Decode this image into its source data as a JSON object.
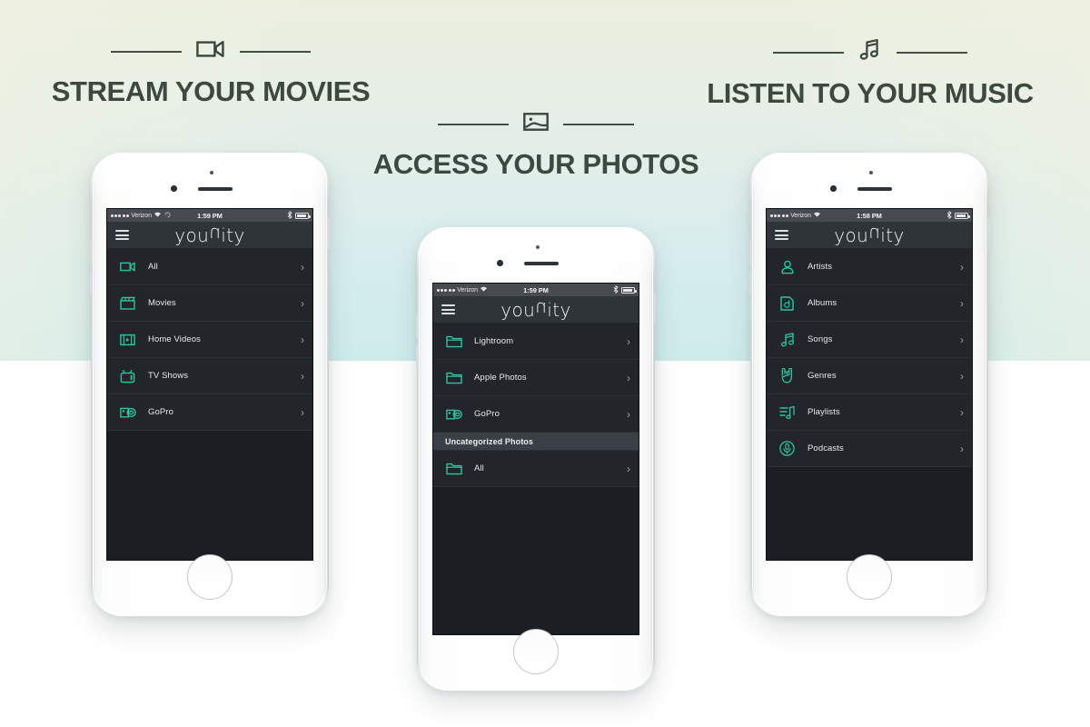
{
  "background": {
    "gradient_top": "#ecefe0",
    "gradient_bottom": "#ceebec",
    "lower_area": "#ffffff"
  },
  "theme": {
    "accent_teal": "#2ec49f",
    "headline_color": "#3c4840",
    "screen_bg": "#22262b",
    "navbar_bg": "#2f3439",
    "statusbar_bg": "#474b50",
    "section_header_bg": "#3a4046"
  },
  "headlines": [
    {
      "id": "movies",
      "title": "STREAM YOUR MOVIES",
      "icon": "video-camera-icon"
    },
    {
      "id": "photos",
      "title": "ACCESS YOUR PHOTOS",
      "icon": "photo-image-icon"
    },
    {
      "id": "music",
      "title": "LISTEN TO YOUR MUSIC",
      "icon": "music-note-icon"
    }
  ],
  "phones": [
    {
      "id": "movies",
      "statusbar": {
        "signal_dots": 5,
        "carrier": "Verizon",
        "wifi": "wifi-icon",
        "rotation_lock": "rotation-lock-icon",
        "time": "1:59 PM",
        "bluetooth": "bluetooth-icon",
        "battery": "battery-icon"
      },
      "navbar": {
        "menu": "hamburger-menu-icon",
        "brand_part1": "you",
        "brand_flip": "u",
        "brand_part2": "ity"
      },
      "rows": [
        {
          "label": "All",
          "icon": "video-camera-icon",
          "chevron": "›"
        },
        {
          "label": "Movies",
          "icon": "clapperboard-icon",
          "chevron": "›"
        },
        {
          "label": "Home Videos",
          "icon": "film-strip-icon",
          "chevron": "›"
        },
        {
          "label": "TV Shows",
          "icon": "television-icon",
          "chevron": "›"
        },
        {
          "label": "GoPro",
          "icon": "gopro-camera-icon",
          "chevron": "›"
        }
      ]
    },
    {
      "id": "photos",
      "statusbar": {
        "signal_dots": 5,
        "carrier": "Verizon",
        "wifi": "wifi-icon",
        "rotation_lock": "",
        "time": "1:59 PM",
        "bluetooth": "bluetooth-icon",
        "battery": "battery-icon"
      },
      "navbar": {
        "menu": "hamburger-menu-icon",
        "brand_part1": "you",
        "brand_flip": "u",
        "brand_part2": "ity"
      },
      "rows": [
        {
          "label": "Lightroom",
          "icon": "folder-icon",
          "chevron": "›"
        },
        {
          "label": "Apple Photos",
          "icon": "folder-icon",
          "chevron": "›"
        },
        {
          "label": "GoPro",
          "icon": "gopro-camera-icon",
          "chevron": "›"
        }
      ],
      "section_header": "Uncategorized Photos",
      "rows_after": [
        {
          "label": "All",
          "icon": "folder-icon",
          "chevron": "›"
        }
      ]
    },
    {
      "id": "music",
      "statusbar": {
        "signal_dots": 5,
        "carrier": "Verizon",
        "wifi": "wifi-icon",
        "rotation_lock": "",
        "time": "1:58 PM",
        "bluetooth": "bluetooth-icon",
        "battery": "battery-icon"
      },
      "navbar": {
        "menu": "hamburger-menu-icon",
        "brand_part1": "you",
        "brand_flip": "u",
        "brand_part2": "ity"
      },
      "rows": [
        {
          "label": "Artists",
          "icon": "person-icon",
          "chevron": "›"
        },
        {
          "label": "Albums",
          "icon": "album-icon",
          "chevron": "›"
        },
        {
          "label": "Songs",
          "icon": "music-note-icon",
          "chevron": "›"
        },
        {
          "label": "Genres",
          "icon": "rock-hand-icon",
          "chevron": "›"
        },
        {
          "label": "Playlists",
          "icon": "playlist-icon",
          "chevron": "›"
        },
        {
          "label": "Podcasts",
          "icon": "podcast-mic-icon",
          "chevron": "›"
        }
      ]
    }
  ]
}
